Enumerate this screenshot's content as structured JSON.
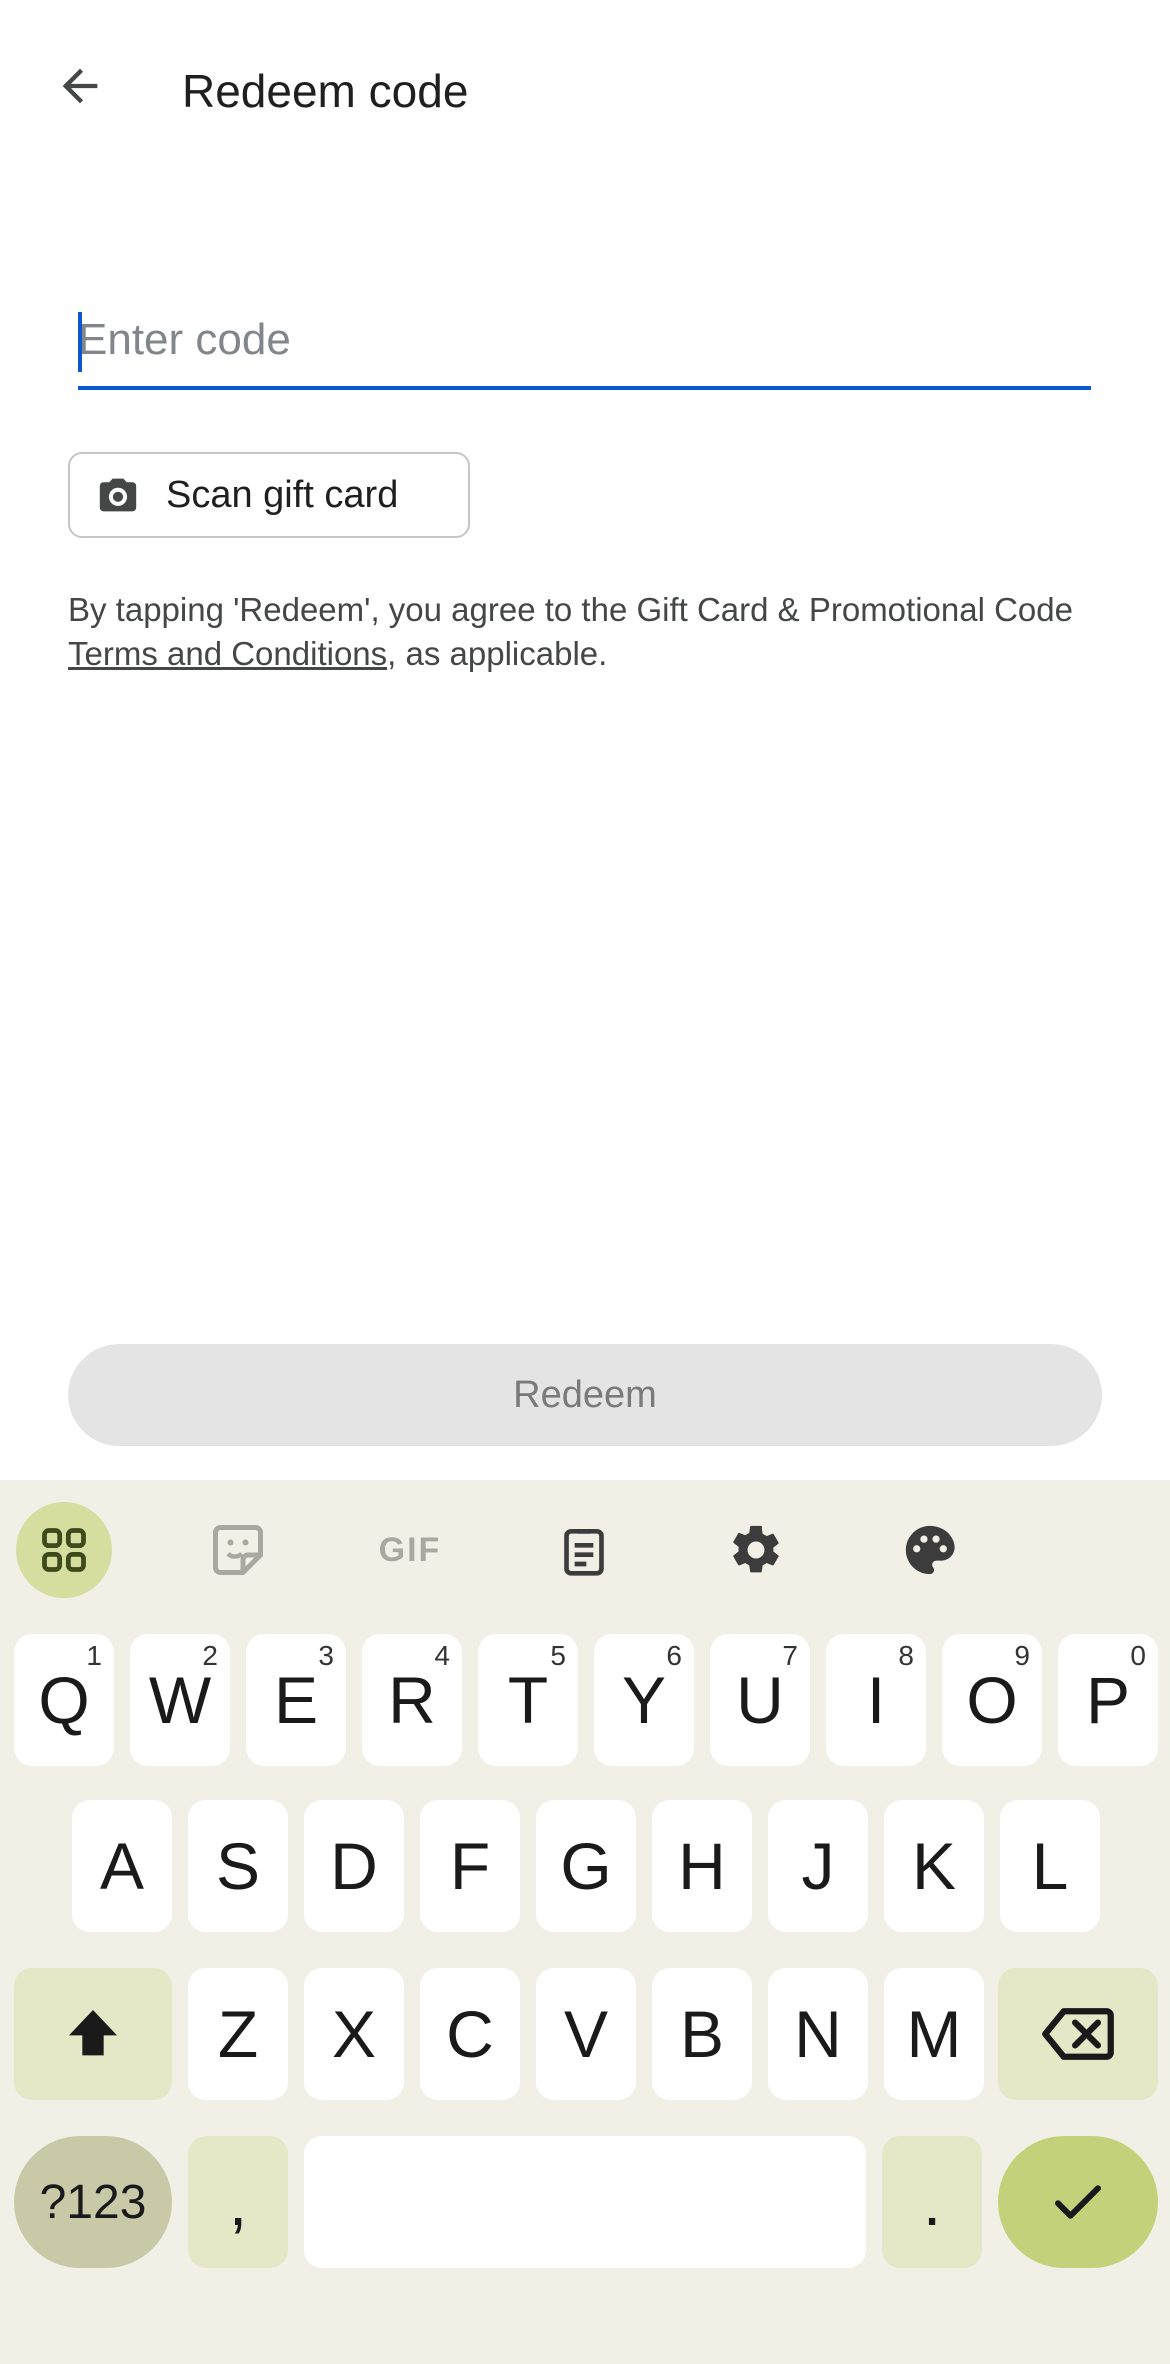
{
  "header": {
    "title": "Redeem code"
  },
  "code_input": {
    "placeholder": "Enter code",
    "value": ""
  },
  "scan_button": {
    "label": "Scan gift card"
  },
  "terms": {
    "prefix": "By tapping 'Redeem', you agree to the Gift Card & Promotional Code ",
    "link": "Terms and Conditions",
    "suffix": ", as applicable."
  },
  "redeem_button": {
    "label": "Redeem"
  },
  "keyboard": {
    "toolbar": [
      "apps-grid-icon",
      "sticker-icon",
      "GIF",
      "clipboard-icon",
      "gear-icon",
      "palette-icon"
    ],
    "row1": [
      {
        "k": "Q",
        "h": "1"
      },
      {
        "k": "W",
        "h": "2"
      },
      {
        "k": "E",
        "h": "3"
      },
      {
        "k": "R",
        "h": "4"
      },
      {
        "k": "T",
        "h": "5"
      },
      {
        "k": "Y",
        "h": "6"
      },
      {
        "k": "U",
        "h": "7"
      },
      {
        "k": "I",
        "h": "8"
      },
      {
        "k": "O",
        "h": "9"
      },
      {
        "k": "P",
        "h": "0"
      }
    ],
    "row2": [
      "A",
      "S",
      "D",
      "F",
      "G",
      "H",
      "J",
      "K",
      "L"
    ],
    "row3": [
      "Z",
      "X",
      "C",
      "V",
      "B",
      "N",
      "M"
    ],
    "symbols_label": "?123",
    "comma": ",",
    "period": "."
  },
  "colors": {
    "accent": "#0b57d0",
    "keyboard_bg": "#f2f0e6",
    "enter_key": "#c3d27a",
    "modifier_key": "#e4e8c6"
  }
}
